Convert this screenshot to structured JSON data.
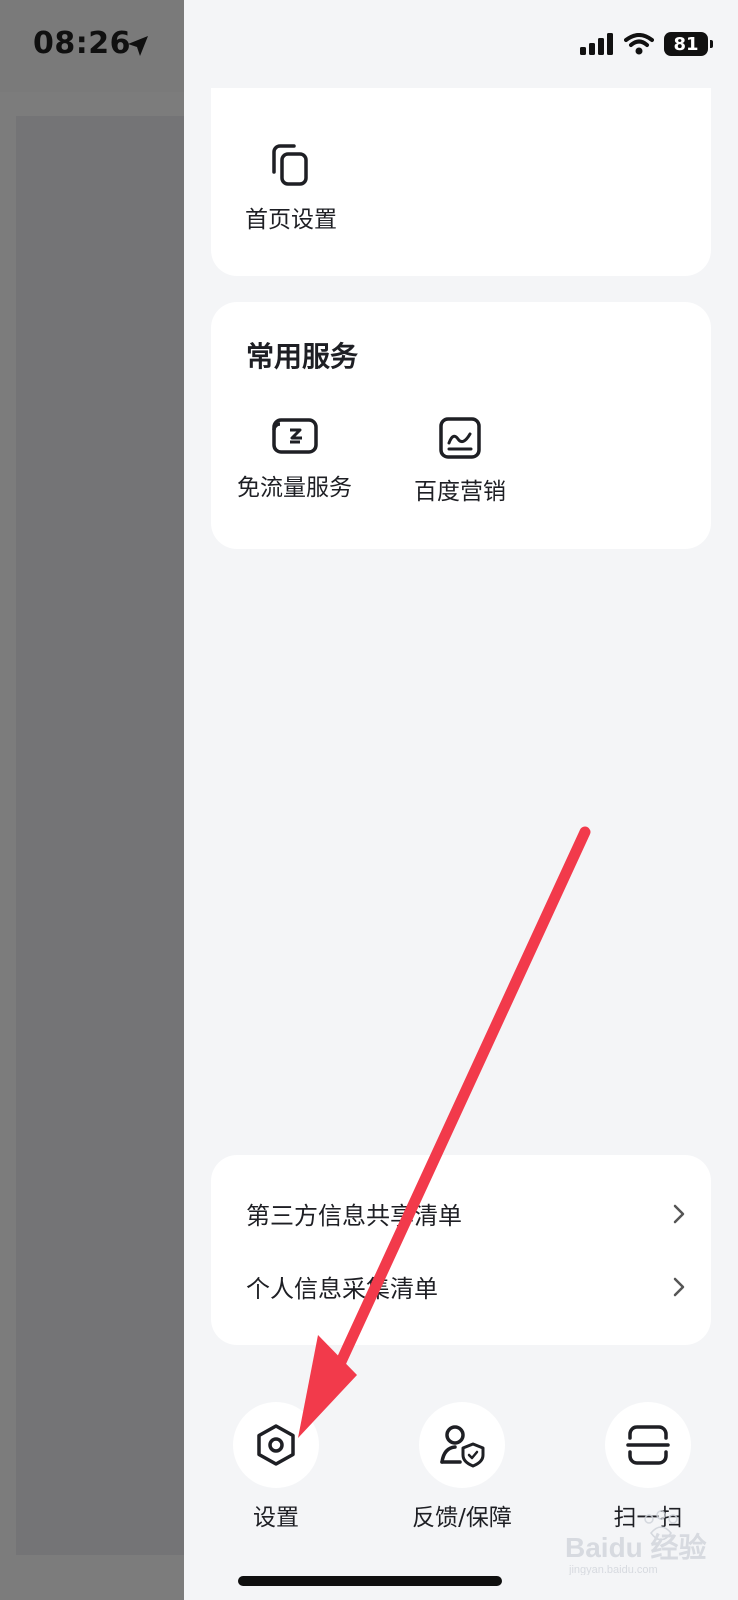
{
  "status_bar": {
    "time": "08:26",
    "battery": "81"
  },
  "top_card": {
    "items": [
      {
        "label": "首页设置",
        "icon": "copy-pages-icon"
      }
    ]
  },
  "common_services": {
    "title": "常用服务",
    "items": [
      {
        "label": "免流量服务",
        "icon": "data-free-icon"
      },
      {
        "label": "百度营销",
        "icon": "marketing-chart-icon"
      }
    ]
  },
  "privacy_list": {
    "items": [
      {
        "label": "第三方信息共享清单"
      },
      {
        "label": "个人信息采集清单"
      }
    ]
  },
  "bottom_actions": [
    {
      "label": "设置",
      "icon": "settings-hex-icon"
    },
    {
      "label": "反馈/保障",
      "icon": "user-shield-icon"
    },
    {
      "label": "扫一扫",
      "icon": "scan-icon"
    }
  ],
  "watermark": {
    "text": "Baidu 经验",
    "sub": "jingyan.baidu.com"
  },
  "colors": {
    "annotation_arrow": "#f23a4b",
    "panel_bg": "#f4f5f7",
    "dim_overlay": "#7c7c7c"
  }
}
